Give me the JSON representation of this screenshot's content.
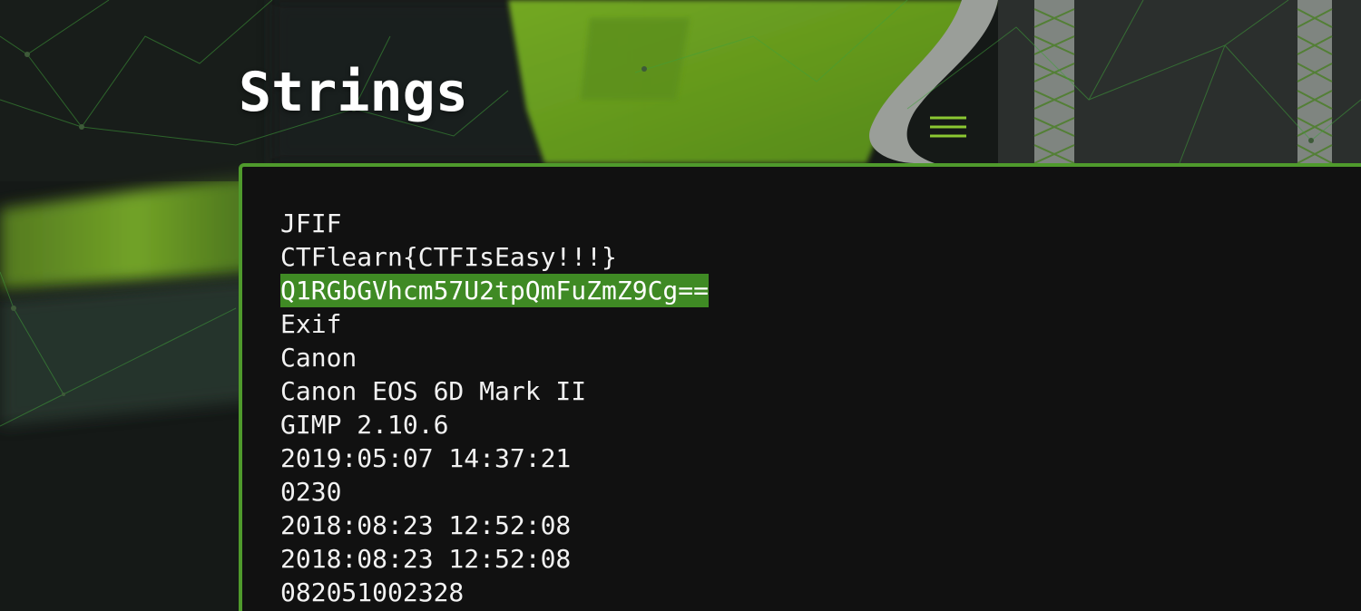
{
  "page": {
    "title": "Strings"
  },
  "colors": {
    "accent_green": "#4f9a2c",
    "highlight_green": "#3f8a24",
    "panel_background": "#111111",
    "text": "#f2f2f2"
  },
  "output": {
    "highlighted_line": "Q1RGbGVhcm57U2tpQmFuZmZ9Cg==",
    "lines": [
      "JFIF",
      "CTFlearn{CTFIsEasy!!!}",
      "Q1RGbGVhcm57U2tpQmFuZmZ9Cg==",
      "Exif",
      "Canon",
      "Canon EOS 6D Mark II",
      "GIMP 2.10.6",
      "2019:05:07 14:37:21",
      "0230",
      "2018:08:23 12:52:08",
      "2018:08:23 12:52:08",
      "082051002328"
    ]
  }
}
